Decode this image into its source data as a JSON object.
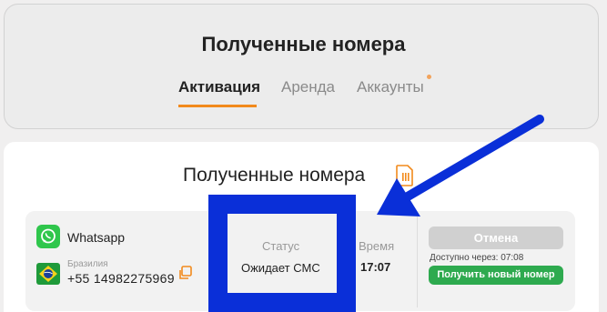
{
  "header": {
    "title": "Полученные номера",
    "tabs": [
      {
        "label": "Активация"
      },
      {
        "label": "Аренда"
      },
      {
        "label": "Аккаунты"
      }
    ]
  },
  "main": {
    "title": "Полученные номера"
  },
  "order": {
    "service": "Whatsapp",
    "country": "Бразилия",
    "phone": "+55 14982275969",
    "status_label": "Статус",
    "status_value": "Ожидает СМС",
    "time_label": "Время",
    "time_value": "17:07",
    "cancel_label": "Отмена",
    "available_text": "Доступно через: 07:08",
    "new_number_label": "Получить новый номер"
  },
  "colors": {
    "accent_orange": "#f28a1c",
    "whatsapp_green": "#2eaa4f",
    "annotation_blue": "#0a2fd8"
  },
  "icons": [
    "whatsapp-icon",
    "brazil-flag-icon",
    "copy-icon",
    "document-icon",
    "annotation-arrow"
  ]
}
